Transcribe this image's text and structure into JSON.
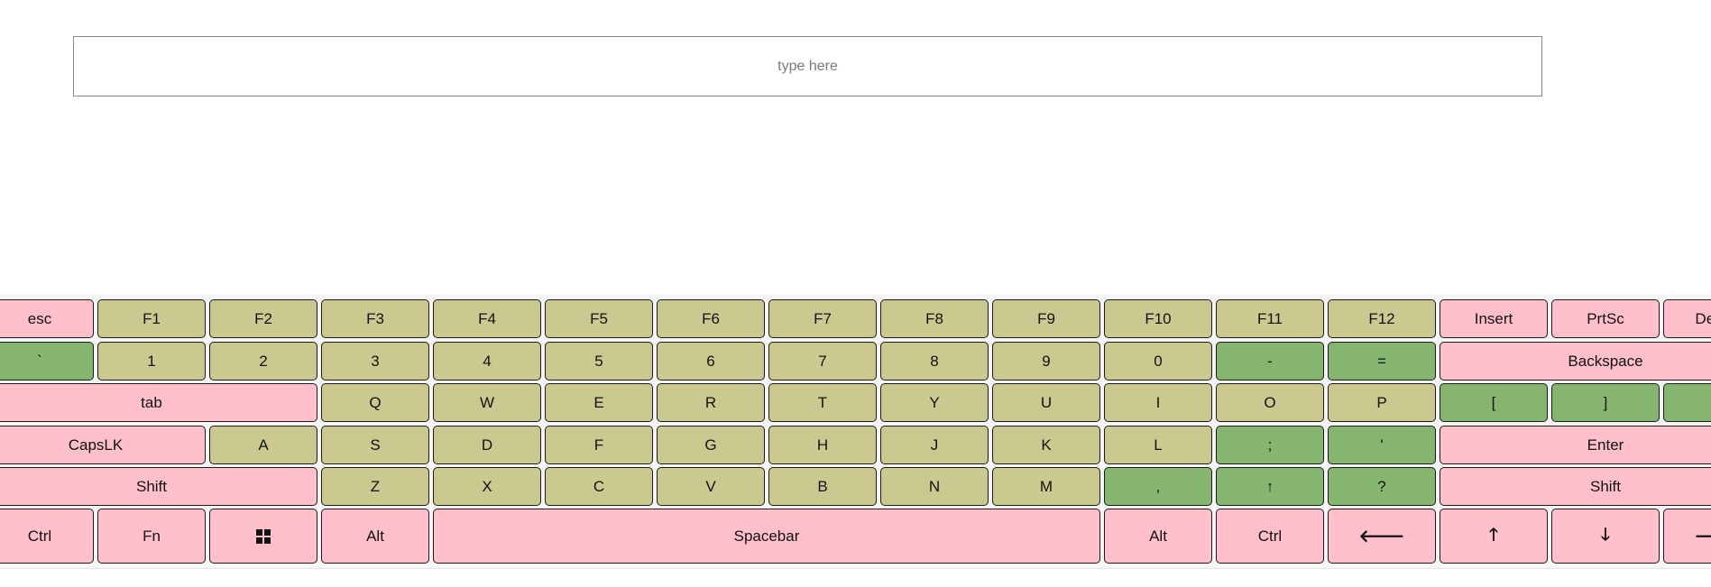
{
  "input": {
    "placeholder": "type here",
    "value": ""
  },
  "colors": {
    "pink": "#ffbfcb",
    "olive": "#cbc98f",
    "green": "#85b56f"
  },
  "keyboard": {
    "rows": [
      [
        {
          "label": "esc",
          "color": "pink"
        },
        {
          "label": "F1",
          "color": "olive"
        },
        {
          "label": "F2",
          "color": "olive"
        },
        {
          "label": "F3",
          "color": "olive"
        },
        {
          "label": "F4",
          "color": "olive"
        },
        {
          "label": "F5",
          "color": "olive"
        },
        {
          "label": "F6",
          "color": "olive"
        },
        {
          "label": "F7",
          "color": "olive"
        },
        {
          "label": "F8",
          "color": "olive"
        },
        {
          "label": "F9",
          "color": "olive"
        },
        {
          "label": "F10",
          "color": "olive"
        },
        {
          "label": "F11",
          "color": "olive"
        },
        {
          "label": "F12",
          "color": "olive"
        },
        {
          "label": "Insert",
          "color": "pink"
        },
        {
          "label": "PrtSc",
          "color": "pink"
        },
        {
          "label": "Delete",
          "color": "pink"
        }
      ],
      [
        {
          "label": "`",
          "color": "green"
        },
        {
          "label": "1",
          "color": "olive"
        },
        {
          "label": "2",
          "color": "olive"
        },
        {
          "label": "3",
          "color": "olive"
        },
        {
          "label": "4",
          "color": "olive"
        },
        {
          "label": "5",
          "color": "olive"
        },
        {
          "label": "6",
          "color": "olive"
        },
        {
          "label": "7",
          "color": "olive"
        },
        {
          "label": "8",
          "color": "olive"
        },
        {
          "label": "9",
          "color": "olive"
        },
        {
          "label": "0",
          "color": "olive"
        },
        {
          "label": "-",
          "color": "green"
        },
        {
          "label": "=",
          "color": "green"
        },
        {
          "label": "Backspace",
          "color": "pink"
        }
      ],
      [
        {
          "label": "tab",
          "color": "pink"
        },
        {
          "label": "Q",
          "color": "olive"
        },
        {
          "label": "W",
          "color": "olive"
        },
        {
          "label": "E",
          "color": "olive"
        },
        {
          "label": "R",
          "color": "olive"
        },
        {
          "label": "T",
          "color": "olive"
        },
        {
          "label": "Y",
          "color": "olive"
        },
        {
          "label": "U",
          "color": "olive"
        },
        {
          "label": "I",
          "color": "olive"
        },
        {
          "label": "O",
          "color": "olive"
        },
        {
          "label": "P",
          "color": "olive"
        },
        {
          "label": "[",
          "color": "green"
        },
        {
          "label": "]",
          "color": "green"
        },
        {
          "label": "\\",
          "color": "green"
        }
      ],
      [
        {
          "label": "CapsLK",
          "color": "pink"
        },
        {
          "label": "A",
          "color": "olive"
        },
        {
          "label": "S",
          "color": "olive"
        },
        {
          "label": "D",
          "color": "olive"
        },
        {
          "label": "F",
          "color": "olive"
        },
        {
          "label": "G",
          "color": "olive"
        },
        {
          "label": "H",
          "color": "olive"
        },
        {
          "label": "J",
          "color": "olive"
        },
        {
          "label": "K",
          "color": "olive"
        },
        {
          "label": "L",
          "color": "olive"
        },
        {
          "label": ";",
          "color": "green"
        },
        {
          "label": "'",
          "color": "green"
        },
        {
          "label": "Enter",
          "color": "pink"
        }
      ],
      [
        {
          "label": "Shift",
          "color": "pink"
        },
        {
          "label": "Z",
          "color": "olive"
        },
        {
          "label": "X",
          "color": "olive"
        },
        {
          "label": "C",
          "color": "olive"
        },
        {
          "label": "V",
          "color": "olive"
        },
        {
          "label": "B",
          "color": "olive"
        },
        {
          "label": "N",
          "color": "olive"
        },
        {
          "label": "M",
          "color": "olive"
        },
        {
          "label": ",",
          "color": "green"
        },
        {
          "label": "↑",
          "color": "green"
        },
        {
          "label": "?",
          "color": "green"
        },
        {
          "label": "Shift",
          "color": "pink"
        }
      ],
      [
        {
          "label": "Ctrl",
          "color": "pink"
        },
        {
          "label": "Fn",
          "color": "pink"
        },
        {
          "label": "",
          "icon": "windows-icon",
          "color": "pink"
        },
        {
          "label": "Alt",
          "color": "pink"
        },
        {
          "label": "Spacebar",
          "color": "pink"
        },
        {
          "label": "Alt",
          "color": "pink"
        },
        {
          "label": "Ctrl",
          "color": "pink"
        },
        {
          "label": "🡐",
          "icon": "arrow-left-icon",
          "color": "pink"
        },
        {
          "label": "🡑",
          "icon": "arrow-up-icon",
          "color": "pink"
        },
        {
          "label": "🡓",
          "icon": "arrow-down-icon",
          "color": "pink"
        },
        {
          "label": "🡒",
          "icon": "arrow-right-icon",
          "color": "pink"
        }
      ]
    ]
  }
}
